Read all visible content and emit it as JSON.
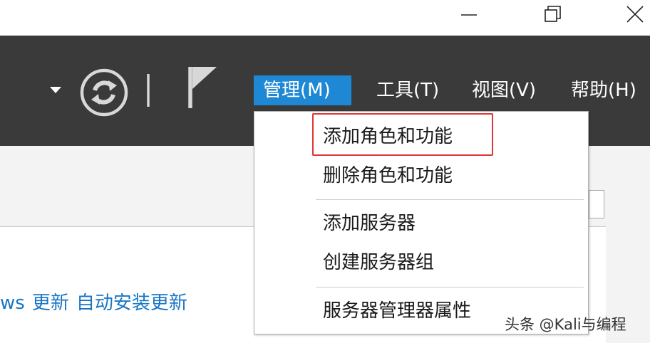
{
  "window_controls": {
    "minimize": "minimize-icon",
    "maximize": "restore-icon",
    "close": "close-icon"
  },
  "toolbar": {
    "icons": [
      "dropdown-arrow-icon",
      "refresh-icon",
      "flag-icon"
    ],
    "menu": [
      {
        "label": "管理(M)",
        "active": true
      },
      {
        "label": "工具(T)",
        "active": false
      },
      {
        "label": "视图(V)",
        "active": false
      },
      {
        "label": "帮助(H)",
        "active": false
      }
    ]
  },
  "dropdown": {
    "items": [
      {
        "label": "添加角色和功能",
        "highlighted": true
      },
      {
        "label": "删除角色和功能"
      },
      {
        "label": "添加服务器"
      },
      {
        "label": "创建服务器组"
      },
      {
        "label": "服务器管理器属性"
      }
    ]
  },
  "content": {
    "link_fragment": "ws",
    "link_update": "更新",
    "link_auto_update": "自动安装更新"
  },
  "watermark": "头条 @Kali与编程",
  "colors": {
    "toolbar_bg": "#3a3a3a",
    "active_menu_bg": "#1e88d4",
    "link": "#1976c5",
    "highlight_border": "#e03535"
  }
}
